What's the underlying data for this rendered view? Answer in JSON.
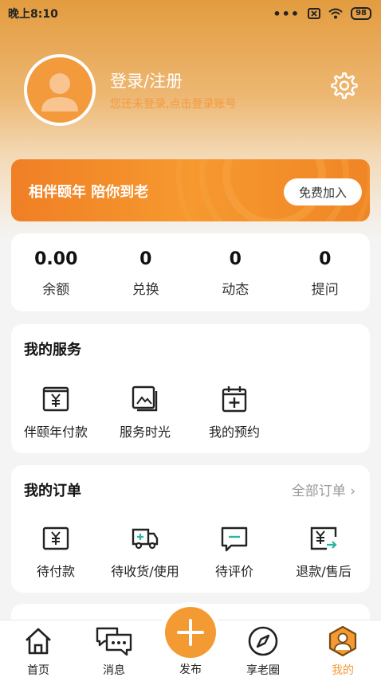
{
  "status": {
    "time": "晚上8:10",
    "battery": "98"
  },
  "profile": {
    "title": "登录/注册",
    "subtitle": "您还未登录,点击登录账号"
  },
  "banner": {
    "text": "相伴颐年 陪你到老",
    "button": "免费加入"
  },
  "stats": [
    {
      "value": "0.00",
      "label": "余额"
    },
    {
      "value": "0",
      "label": "兑换"
    },
    {
      "value": "0",
      "label": "动态"
    },
    {
      "value": "0",
      "label": "提问"
    }
  ],
  "services": {
    "title": "我的服务",
    "items": [
      {
        "label": "伴颐年付款",
        "icon": "yuan-payment-icon"
      },
      {
        "label": "服务时光",
        "icon": "photo-gallery-icon"
      },
      {
        "label": "我的预约",
        "icon": "calendar-add-icon"
      }
    ]
  },
  "orders": {
    "title": "我的订单",
    "all_link": "全部订单 ›",
    "items": [
      {
        "label": "待付款",
        "icon": "yuan-wallet-icon"
      },
      {
        "label": "待收货/使用",
        "icon": "delivery-truck-icon"
      },
      {
        "label": "待评价",
        "icon": "comment-icon"
      },
      {
        "label": "退款/售后",
        "icon": "refund-icon"
      }
    ]
  },
  "tabbar": {
    "items": [
      {
        "label": "首页",
        "icon": "home-icon"
      },
      {
        "label": "消息",
        "icon": "message-icon"
      },
      {
        "label": "发布",
        "icon": "plus-icon"
      },
      {
        "label": "享老圈",
        "icon": "compass-icon"
      },
      {
        "label": "我的",
        "icon": "user-icon"
      }
    ],
    "active": "我的"
  },
  "colors": {
    "accent": "#f39a33",
    "banner": "#f08525",
    "hint": "#f39a3d"
  }
}
